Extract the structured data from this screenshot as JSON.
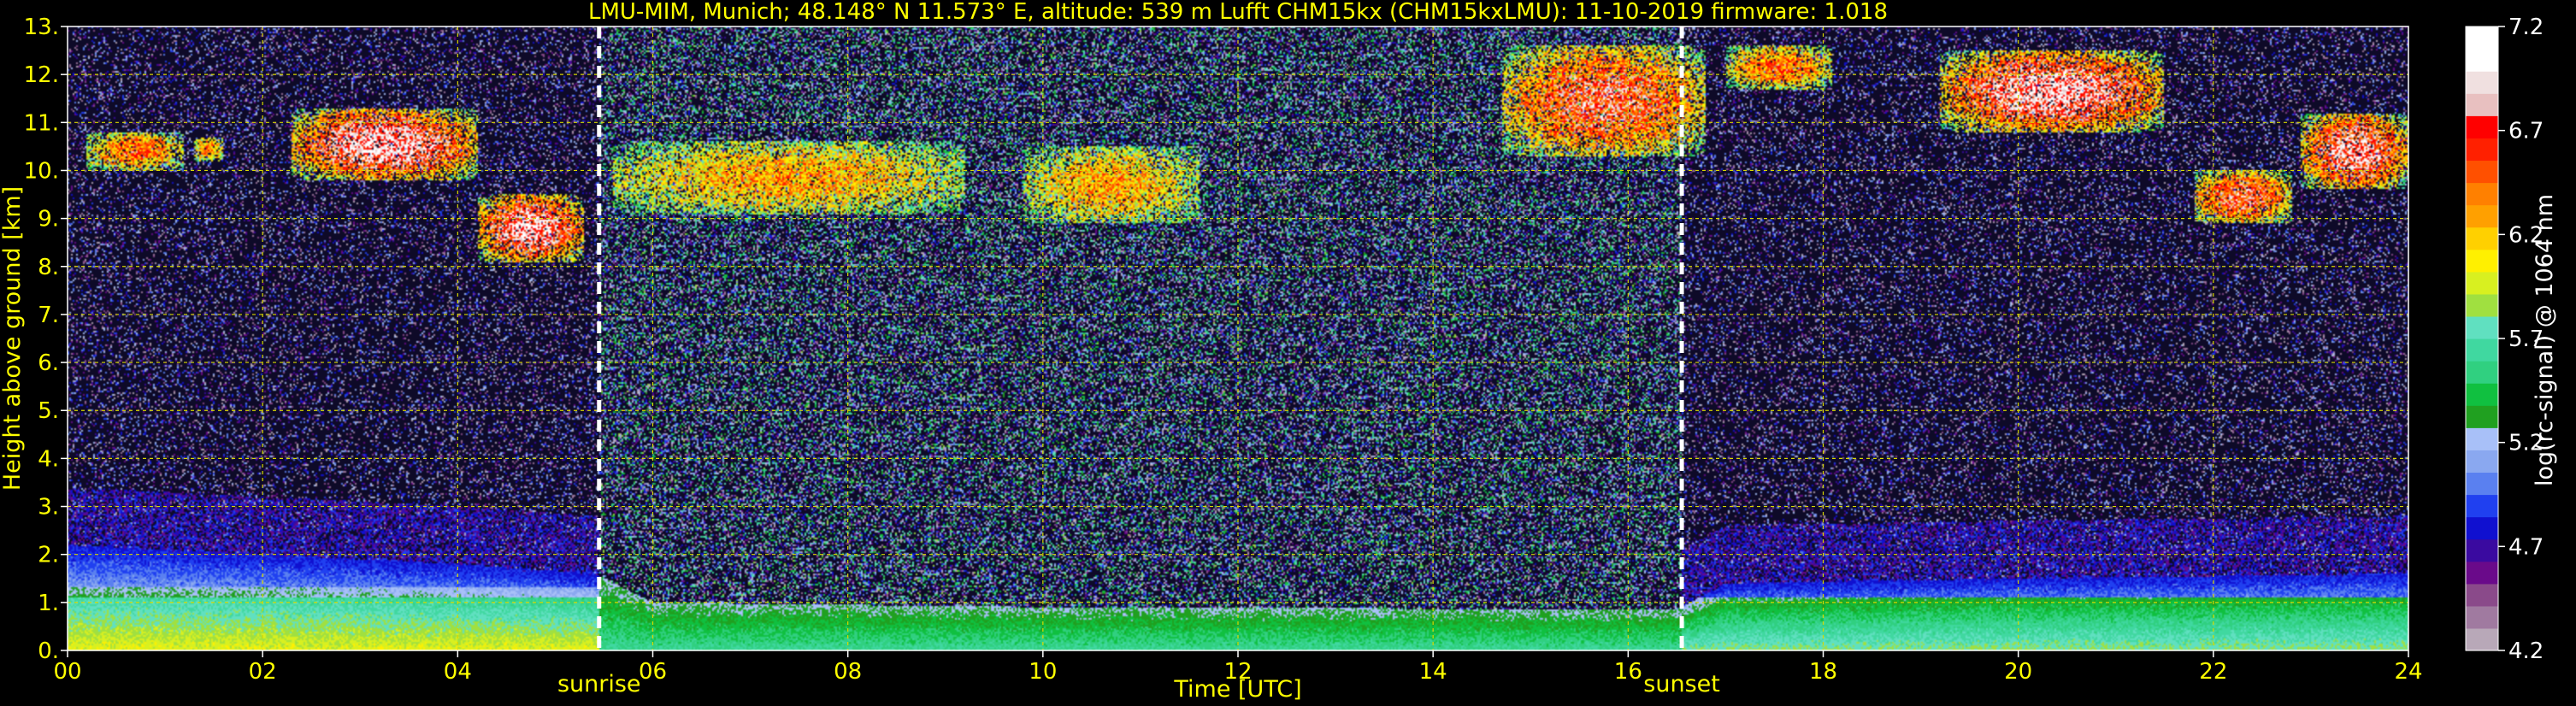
{
  "chart_data": {
    "type": "heatmap",
    "title": "LMU-MIM, Munich; 48.148° N 11.573° E, altitude: 539 m    Lufft CHM15kx (CHM15kxLMU): 11-10-2019    firmware: 1.018",
    "xlabel": "Time [UTC]",
    "ylabel": "Height above ground [km]",
    "xlim": [
      0,
      24
    ],
    "ylim": [
      0,
      13
    ],
    "x_ticks": [
      "00",
      "02",
      "04",
      "06",
      "08",
      "10",
      "12",
      "14",
      "16",
      "18",
      "20",
      "22",
      "24"
    ],
    "y_ticks": [
      "0.",
      "1.",
      "2.",
      "3.",
      "4.",
      "5.",
      "6.",
      "7.",
      "8.",
      "9.",
      "10.",
      "11.",
      "12.",
      "13."
    ],
    "grid": true,
    "colorbar": {
      "label": "log(rc-signal) @ 1064 nm",
      "range": [
        4.2,
        7.2
      ],
      "ticks": [
        "4.2",
        "4.7",
        "5.2",
        "5.7",
        "6.2",
        "6.7",
        "7.2"
      ],
      "colors": [
        "#b8a8b8",
        "#a07aa0",
        "#8a4a8a",
        "#6a0a8a",
        "#3a0aa0",
        "#1010d0",
        "#2040f0",
        "#5a80f0",
        "#8aa8f0",
        "#a8c0f8",
        "#20a020",
        "#10c040",
        "#30d080",
        "#40d8a0",
        "#60e0c0",
        "#a0e040",
        "#d8f020",
        "#fff000",
        "#ffd000",
        "#ffa000",
        "#ff8000",
        "#ff5000",
        "#ff2000",
        "#ff0000",
        "#e8c0c0",
        "#f0e0e0",
        "#ffffff",
        "#ffffff"
      ]
    },
    "vlines": [
      {
        "label": "sunrise",
        "x": 5.45
      },
      {
        "label": "sunset",
        "x": 16.55
      }
    ],
    "features": {
      "boundary_layer_top_km": [
        [
          0,
          2.2
        ],
        [
          2,
          2.0
        ],
        [
          4,
          1.8
        ],
        [
          5.4,
          1.6
        ],
        [
          6,
          1.0
        ],
        [
          10,
          0.9
        ],
        [
          16.5,
          0.85
        ],
        [
          17,
          1.4
        ],
        [
          20,
          1.5
        ],
        [
          24,
          1.6
        ]
      ],
      "clouds": [
        {
          "t": [
            0.2,
            1.2
          ],
          "h": [
            10.0,
            10.8
          ],
          "intensity": 0.55
        },
        {
          "t": [
            1.3,
            1.6
          ],
          "h": [
            10.2,
            10.7
          ],
          "intensity": 0.5
        },
        {
          "t": [
            2.3,
            4.2
          ],
          "h": [
            9.8,
            11.3
          ],
          "intensity": 0.85
        },
        {
          "t": [
            4.2,
            5.3
          ],
          "h": [
            8.1,
            9.5
          ],
          "intensity": 0.85
        },
        {
          "t": [
            5.6,
            9.2
          ],
          "h": [
            9.1,
            10.6
          ],
          "intensity": 0.45
        },
        {
          "t": [
            9.8,
            11.6
          ],
          "h": [
            8.9,
            10.5
          ],
          "intensity": 0.45
        },
        {
          "t": [
            14.7,
            16.8
          ],
          "h": [
            10.3,
            12.6
          ],
          "intensity": 0.7
        },
        {
          "t": [
            17.0,
            18.1
          ],
          "h": [
            11.7,
            12.6
          ],
          "intensity": 0.55
        },
        {
          "t": [
            19.2,
            21.5
          ],
          "h": [
            10.8,
            12.5
          ],
          "intensity": 0.85
        },
        {
          "t": [
            21.8,
            22.8
          ],
          "h": [
            8.9,
            10.0
          ],
          "intensity": 0.7
        },
        {
          "t": [
            22.9,
            24.0
          ],
          "h": [
            9.6,
            11.2
          ],
          "intensity": 0.8
        }
      ]
    }
  }
}
